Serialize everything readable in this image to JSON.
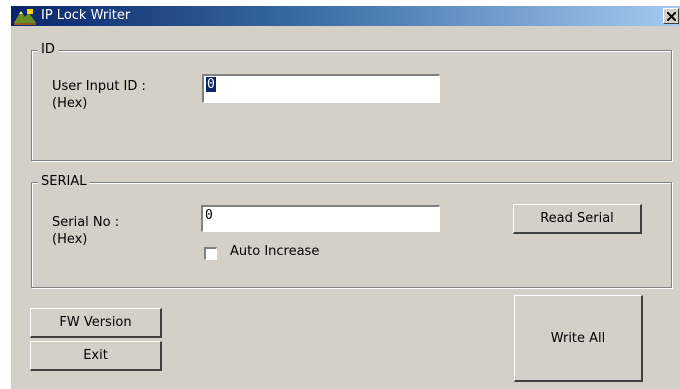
{
  "window": {
    "title": "IP Lock Writer",
    "icons": {
      "app": "app-icon",
      "close": "close-icon"
    }
  },
  "id_group": {
    "legend": "ID",
    "user_input_label_line1": "User Input ID :",
    "user_input_label_line2": "(Hex)",
    "user_input_value": "0"
  },
  "serial_group": {
    "legend": "SERIAL",
    "serial_label_line1": "Serial No :",
    "serial_label_line2": "(Hex)",
    "serial_value": "0",
    "read_serial_label": "Read Serial",
    "auto_increase_label": "Auto Increase",
    "auto_increase_checked": false
  },
  "buttons": {
    "fw_version": "FW Version",
    "exit": "Exit",
    "write_all": "Write All"
  },
  "colors": {
    "face": "#d4d0c8",
    "title_start": "#0a246a",
    "title_end": "#a6caf0",
    "selection": "#0a246a"
  }
}
